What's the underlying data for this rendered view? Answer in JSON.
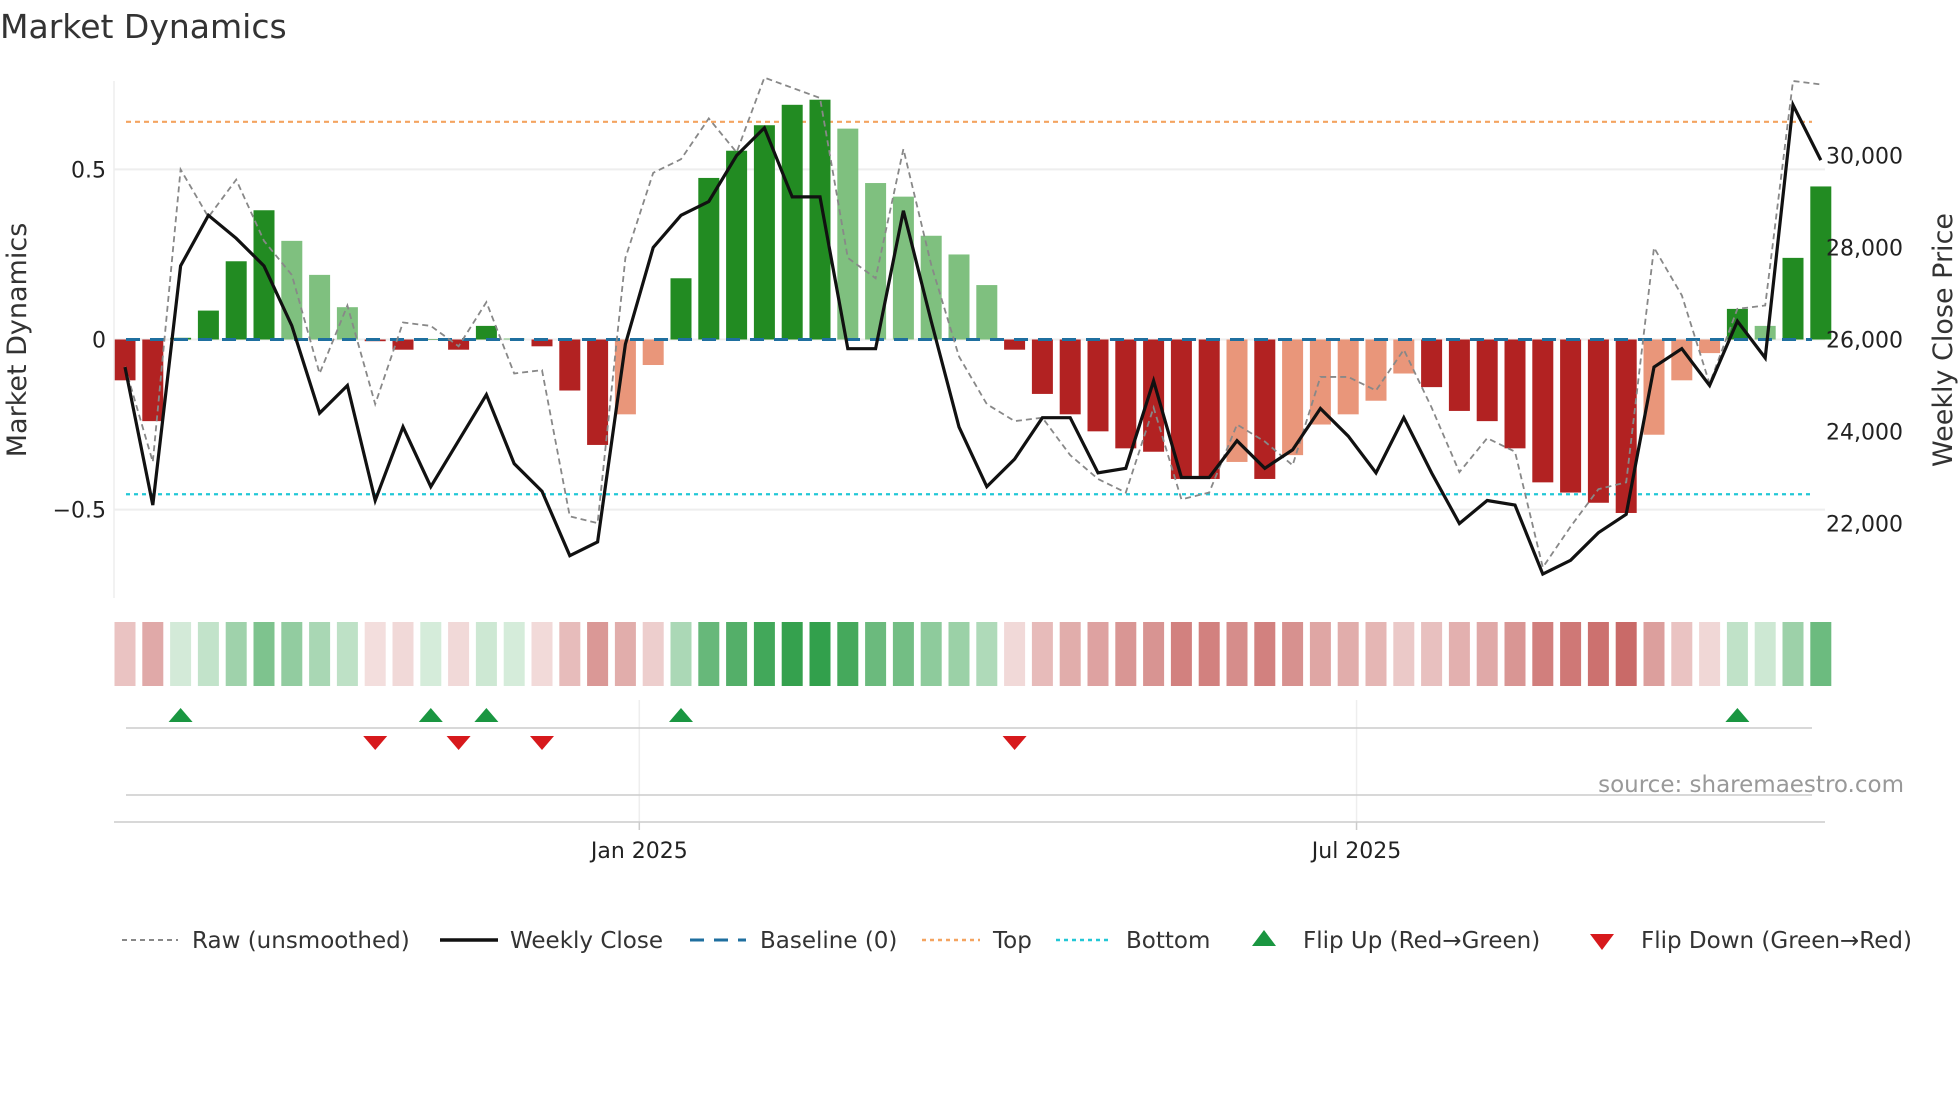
{
  "title": "Market Dynamics",
  "source": "source: sharemaestro.com",
  "colors": {
    "strong_green": "#228B22",
    "weak_green": "#7fc07f",
    "strong_red": "#b22222",
    "weak_red": "#e9967a",
    "raw": "#888888",
    "close": "#111111",
    "baseline": "#1f6f9f",
    "top": "#f4a460",
    "bottom": "#22c7d6",
    "flip_up": "#1a9641",
    "flip_down": "#d7191c"
  },
  "chart_data": {
    "type": "bar",
    "title": "Market Dynamics",
    "ylabel": "Market Dynamics",
    "y2label": "Weekly Close Price",
    "ylim": [
      -0.76,
      0.76
    ],
    "y2lim": [
      20380,
      31620
    ],
    "yticks": [
      {
        "v": 0.5,
        "label": "0.5"
      },
      {
        "v": 0,
        "label": "0"
      },
      {
        "v": -0.5,
        "label": "−0.5"
      }
    ],
    "y2ticks": [
      {
        "v": 30000,
        "label": "30,000"
      },
      {
        "v": 28000,
        "label": "28,000"
      },
      {
        "v": 26000,
        "label": "26,000"
      },
      {
        "v": 24000,
        "label": "24,000"
      },
      {
        "v": 22000,
        "label": "22,000"
      }
    ],
    "xticks": [
      {
        "after_index": 18.5,
        "label": "Jan 2025"
      },
      {
        "after_index": 44.3,
        "label": "Jul 2025"
      }
    ],
    "top_level": 0.64,
    "bottom_level": -0.455,
    "baseline": 0,
    "dynamics": [
      -0.12,
      -0.24,
      0.005,
      0.085,
      0.23,
      0.38,
      0.29,
      0.19,
      0.095,
      -0.005,
      -0.03,
      0.0,
      -0.03,
      0.04,
      0.003,
      -0.02,
      -0.15,
      -0.31,
      -0.22,
      -0.075,
      0.18,
      0.475,
      0.555,
      0.63,
      0.69,
      0.705,
      0.62,
      0.46,
      0.42,
      0.305,
      0.25,
      0.16,
      -0.03,
      -0.16,
      -0.22,
      -0.27,
      -0.32,
      -0.33,
      -0.41,
      -0.41,
      -0.36,
      -0.41,
      -0.34,
      -0.25,
      -0.22,
      -0.18,
      -0.1,
      -0.14,
      -0.21,
      -0.24,
      -0.32,
      -0.42,
      -0.45,
      -0.48,
      -0.51,
      -0.28,
      -0.12,
      -0.04,
      0.09,
      0.04,
      0.24,
      0.45
    ],
    "strength": [
      "s",
      "s",
      "s",
      "s",
      "s",
      "s",
      "w",
      "w",
      "w",
      "s",
      "s",
      "s",
      "s",
      "s",
      "w",
      "s",
      "s",
      "s",
      "w",
      "w",
      "s",
      "s",
      "s",
      "s",
      "s",
      "s",
      "w",
      "w",
      "w",
      "w",
      "w",
      "w",
      "s",
      "s",
      "s",
      "s",
      "s",
      "s",
      "s",
      "s",
      "w",
      "s",
      "w",
      "w",
      "w",
      "w",
      "w",
      "s",
      "s",
      "s",
      "s",
      "s",
      "s",
      "s",
      "s",
      "w",
      "w",
      "w",
      "s",
      "w",
      "s",
      "s"
    ],
    "raw": [
      -0.08,
      -0.36,
      0.5,
      0.36,
      0.47,
      0.29,
      0.19,
      -0.1,
      0.1,
      -0.19,
      0.05,
      0.04,
      -0.02,
      0.11,
      -0.1,
      -0.09,
      -0.52,
      -0.54,
      0.24,
      0.49,
      0.53,
      0.65,
      0.55,
      0.77,
      0.74,
      0.71,
      0.24,
      0.18,
      0.56,
      0.22,
      -0.05,
      -0.19,
      -0.24,
      -0.23,
      -0.34,
      -0.41,
      -0.45,
      -0.2,
      -0.47,
      -0.45,
      -0.25,
      -0.3,
      -0.37,
      -0.11,
      -0.11,
      -0.15,
      -0.03,
      -0.2,
      -0.39,
      -0.29,
      -0.33,
      -0.67,
      -0.55,
      -0.44,
      -0.42,
      0.27,
      0.13,
      -0.13,
      0.09,
      0.1,
      0.76,
      0.75
    ],
    "weekly_close": [
      25400,
      22400,
      27600,
      28700,
      28200,
      27600,
      26300,
      24400,
      25000,
      22500,
      24100,
      22800,
      23800,
      24800,
      23300,
      22700,
      21300,
      21600,
      25900,
      28000,
      28700,
      29000,
      30000,
      30600,
      29100,
      29100,
      25800,
      25800,
      28800,
      26400,
      24100,
      22800,
      23400,
      24300,
      24300,
      23100,
      23200,
      25100,
      23000,
      23000,
      23800,
      23200,
      23600,
      24500,
      23900,
      23100,
      24300,
      23100,
      22000,
      22500,
      22400,
      20900,
      21200,
      21800,
      22200,
      25400,
      25800,
      25000,
      26400,
      25600,
      31100,
      29900
    ],
    "flip_up_indices": [
      2,
      11,
      13,
      20,
      58
    ],
    "flip_down_indices": [
      9,
      12,
      15,
      32
    ]
  },
  "legend": {
    "raw": "Raw (unsmoothed)",
    "close": "Weekly Close",
    "baseline": "Baseline (0)",
    "top": "Top",
    "bottom": "Bottom",
    "flip_up": "Flip Up (Red→Green)",
    "flip_down": "Flip Down (Green→Red)"
  }
}
